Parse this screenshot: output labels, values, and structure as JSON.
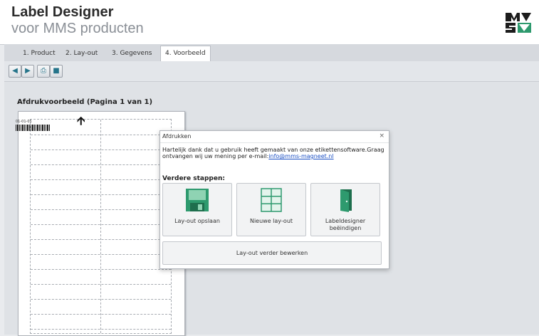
{
  "app": {
    "title": "Label Designer",
    "subtitle": "voor MMS producten"
  },
  "tabs": [
    {
      "label": "1. Product"
    },
    {
      "label": "2. Lay-out"
    },
    {
      "label": "3. Gegevens"
    },
    {
      "label": "4. Voorbeeld",
      "active": true
    }
  ],
  "toolbar": {
    "buttons": [
      {
        "icon": "arrow-left-icon"
      },
      {
        "icon": "arrow-right-icon"
      },
      {
        "icon": "printer-icon"
      },
      {
        "icon": "floppy-save-icon"
      }
    ]
  },
  "preview": {
    "title": "Afdrukvoorbeeld (Pagina 1 van 1)",
    "first_label_code": "01-01-01"
  },
  "dialog": {
    "title": "Afdrukken",
    "close": "×",
    "message": "Hartelijk dank dat u gebruik heeft gemaakt van onze etikettensoftware.Graag ontvangen wij uw mening per e-mail:",
    "email": "info@mms-magneet.nl",
    "steps_heading": "Verdere stappen:",
    "buttons": {
      "save": "Lay-out opslaan",
      "new": "Nieuwe lay-out",
      "quit": "Labeldesigner beëindigen",
      "edit": "Lay-out verder bewerken"
    }
  },
  "colors": {
    "accent_green": "#2e9a6e",
    "link_blue": "#1a4fc4"
  }
}
